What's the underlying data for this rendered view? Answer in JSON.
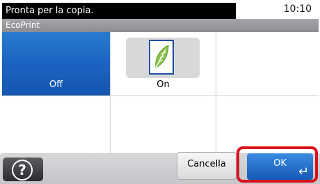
{
  "status": {
    "message": "Pronta per la copia.",
    "time": "10:10"
  },
  "title": "EcoPrint",
  "options": [
    {
      "label": "Off",
      "selected": true
    },
    {
      "label": "On",
      "selected": false
    }
  ],
  "buttons": {
    "help_label": "?",
    "cancel_label": "Cancella",
    "ok_label": "OK"
  },
  "colors": {
    "selected": "#1b63c1",
    "highlight": "#d8121d"
  },
  "icons": {
    "leaf": "leaf-icon",
    "enter": "enter-icon",
    "help": "help-icon"
  }
}
